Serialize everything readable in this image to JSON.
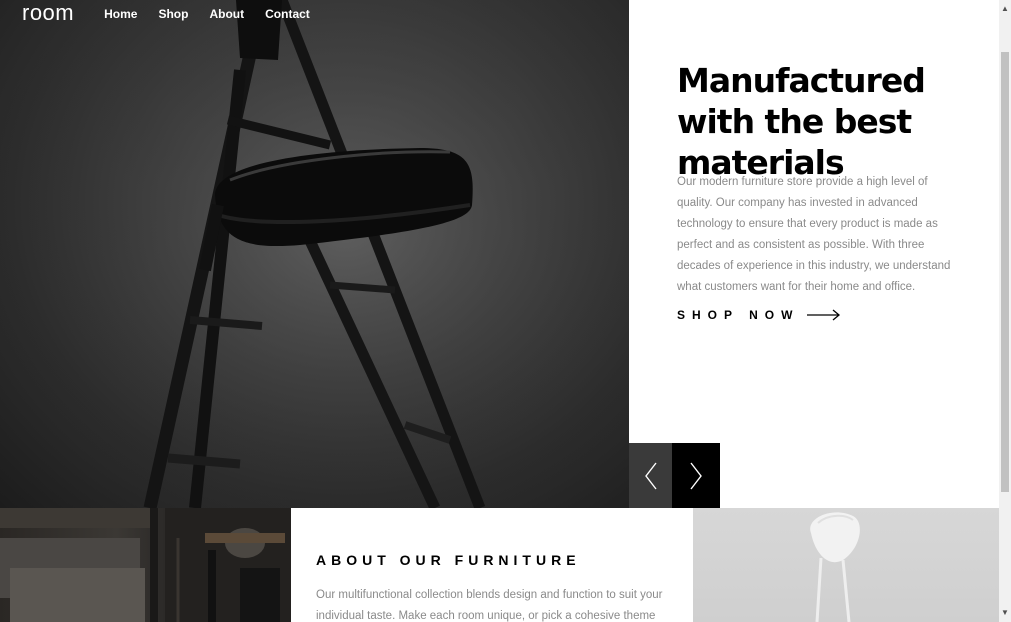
{
  "brand": {
    "logo": "room"
  },
  "nav": {
    "items": [
      "Home",
      "Shop",
      "About",
      "Contact"
    ]
  },
  "hero": {
    "headline": "Manufactured with the best materials",
    "description": "Our modern furniture store provide a high level of quality. Our company has invested in advanced technology to ensure that every product is made as perfect and as consistent as possible. With three decades of experience in this industry, we understand what customers want for their home and office.",
    "cta_label": "SHOP NOW"
  },
  "about": {
    "heading": "ABOUT OUR FURNITURE",
    "text": "Our multifunctional collection blends design and function to suit your individual taste. Make each room unique, or pick a cohesive theme that best express your"
  },
  "icons": {
    "prev": "chevron-left-icon",
    "next": "chevron-right-icon",
    "cta_arrow": "arrow-right-icon",
    "scroll_up": "triangle-up-icon",
    "scroll_down": "triangle-down-icon"
  },
  "colors": {
    "text_primary": "#000000",
    "text_muted": "#8a8a8a",
    "prev_button": "#3a3a3a",
    "next_button": "#000000"
  }
}
